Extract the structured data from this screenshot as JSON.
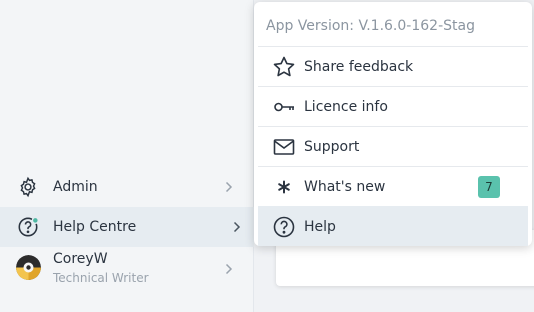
{
  "sidebar": {
    "items": [
      {
        "label": "Admin",
        "icon": "gear-icon"
      },
      {
        "label": "Help Centre",
        "icon": "help-circle-icon",
        "status_dot_color": "#4fb8a3"
      },
      {
        "label": "CoreyW",
        "sublabel": "Technical Writer",
        "icon": "avatar"
      }
    ]
  },
  "menu": {
    "version": "App Version: V.1.6.0-162-Stag",
    "items": [
      {
        "label": "Share feedback",
        "icon": "star-icon"
      },
      {
        "label": "Licence info",
        "icon": "key-icon"
      },
      {
        "label": "Support",
        "icon": "envelope-icon"
      },
      {
        "label": "What's new",
        "icon": "asterisk-icon",
        "badge": "7"
      },
      {
        "label": "Help",
        "icon": "help-circle-icon"
      }
    ]
  },
  "colors": {
    "accent_badge": "#5ac2ad",
    "active_background": "#e6ecf1",
    "text": "#2b3440"
  }
}
